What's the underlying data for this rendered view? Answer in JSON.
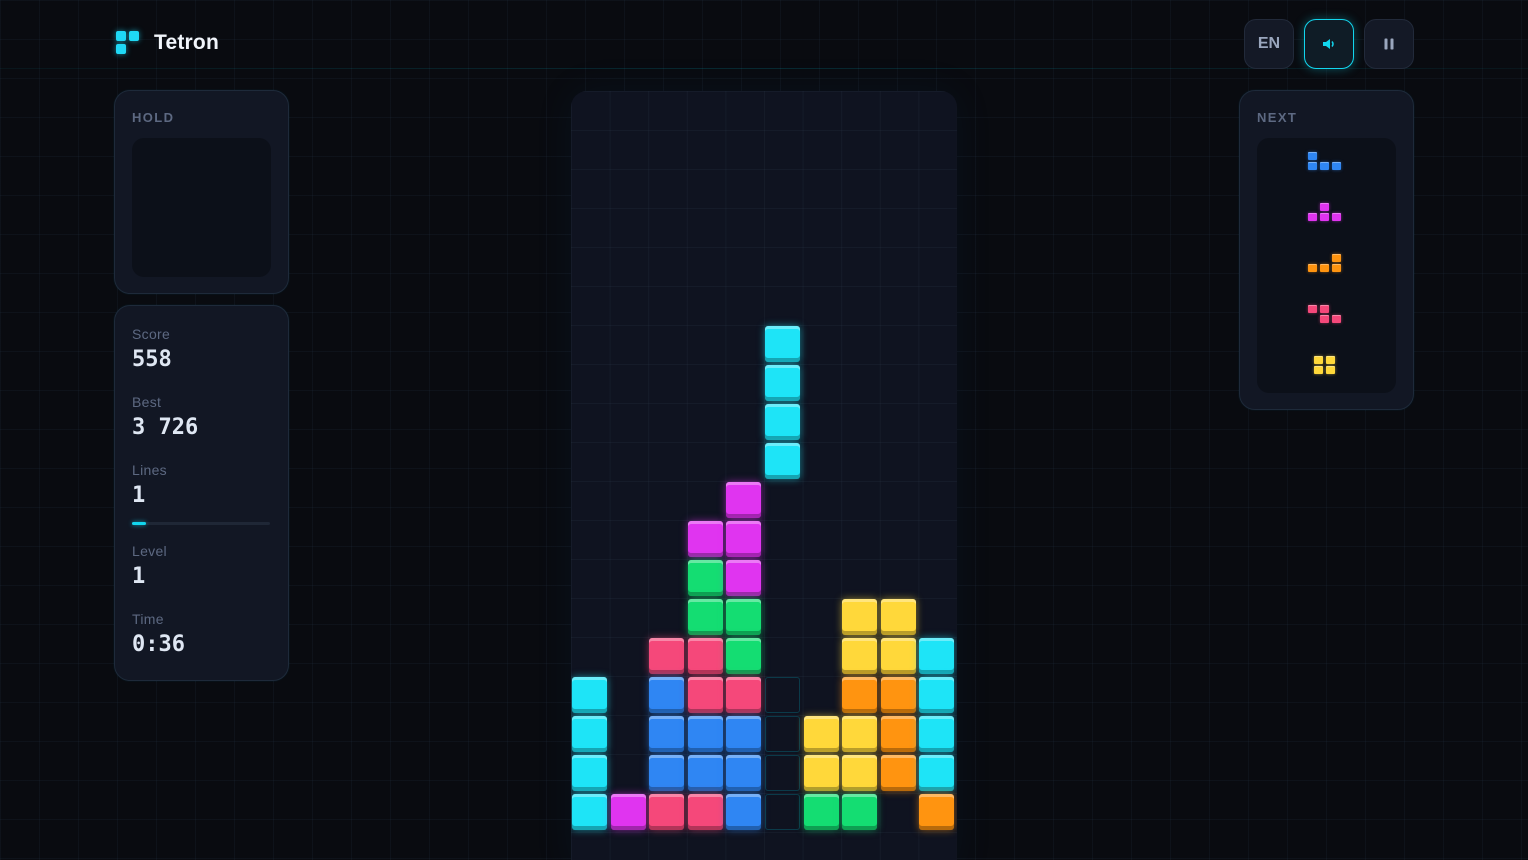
{
  "app": {
    "title": "Tetron"
  },
  "controls": {
    "language": "EN",
    "sound_icon": "speaker-icon",
    "pause_icon": "pause-icon"
  },
  "hold": {
    "title": "HOLD",
    "piece": null
  },
  "stats": {
    "score_label": "Score",
    "score": "558",
    "best_label": "Best",
    "best": "3 726",
    "lines_label": "Lines",
    "lines": "1",
    "lines_progress": 0.1,
    "level_label": "Level",
    "level": "1",
    "time_label": "Time",
    "time": "0:36"
  },
  "next": {
    "title": "NEXT",
    "pieces": [
      "J",
      "T",
      "L",
      "Z",
      "O"
    ]
  },
  "colors": {
    "I": "#1ee4f7",
    "J": "#2f86f3",
    "L": "#ff9410",
    "O": "#ffd83a",
    "S": "#14dd72",
    "T": "#e034f0",
    "Z": "#f5487a",
    "ghost": "#12d6ee"
  },
  "board": {
    "cols": 10,
    "rows": 20,
    "grid": [
      "..........",
      "..........",
      "..........",
      "..........",
      "..........",
      "..........",
      "..........",
      "..........",
      "..........",
      "..........",
      "....T.....",
      "...TT.....",
      "...ST.....",
      "...SS..OO.",
      "..ZZS..OOI",
      "I.JZZ..LLI",
      "I.JJJ.OOLI",
      "I.JJJ.OOLI",
      "ITZZJ.SS.L"
    ],
    "active_piece": {
      "type": "I",
      "cells": [
        [
          5,
          6
        ],
        [
          5,
          7
        ],
        [
          5,
          8
        ],
        [
          5,
          9
        ]
      ]
    },
    "ghost_cells": [
      [
        5,
        15
      ],
      [
        5,
        16
      ],
      [
        5,
        17
      ],
      [
        5,
        18
      ]
    ]
  }
}
